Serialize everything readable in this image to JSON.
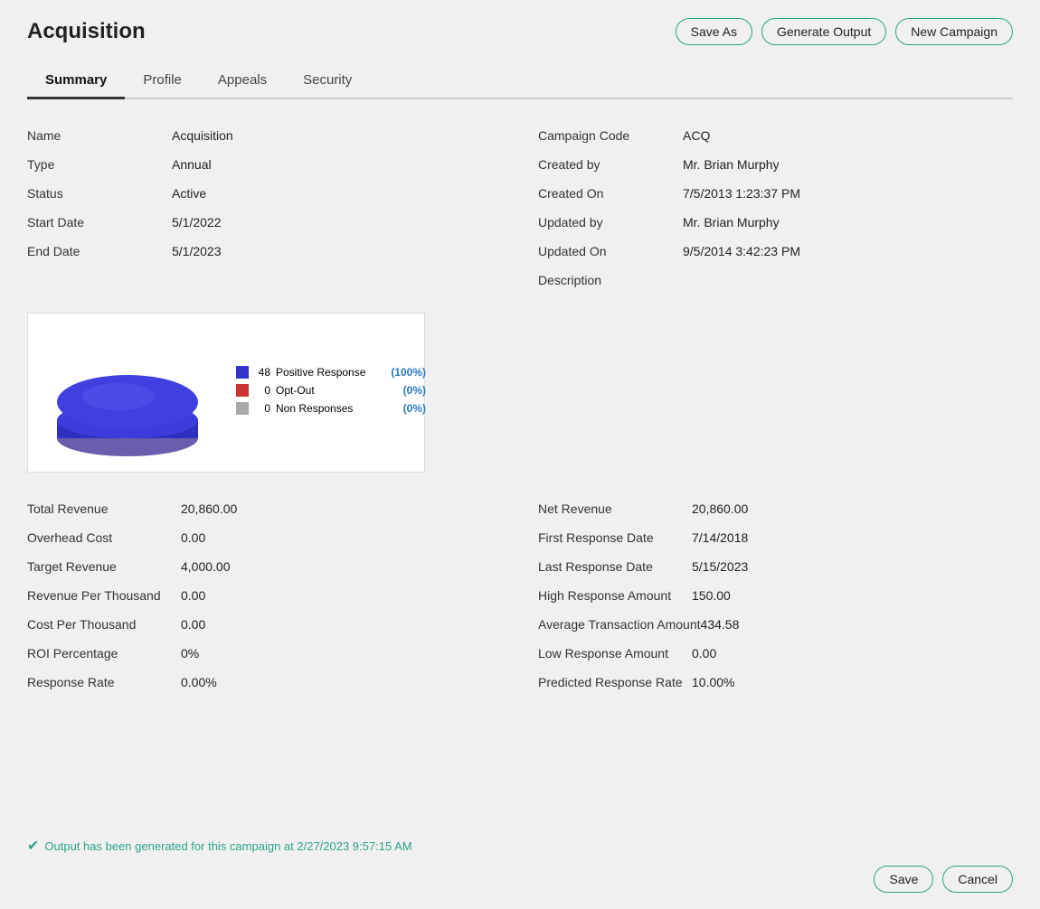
{
  "page": {
    "title": "Acquisition"
  },
  "header": {
    "save_as_label": "Save As",
    "generate_output_label": "Generate Output",
    "new_campaign_label": "New Campaign"
  },
  "tabs": [
    {
      "id": "summary",
      "label": "Summary",
      "active": true
    },
    {
      "id": "profile",
      "label": "Profile",
      "active": false
    },
    {
      "id": "appeals",
      "label": "Appeals",
      "active": false
    },
    {
      "id": "security",
      "label": "Security",
      "active": false
    }
  ],
  "summary": {
    "name_label": "Name",
    "name_value": "Acquisition",
    "type_label": "Type",
    "type_value": "Annual",
    "status_label": "Status",
    "status_value": "Active",
    "start_date_label": "Start Date",
    "start_date_value": "5/1/2022",
    "end_date_label": "End Date",
    "end_date_value": "5/1/2023",
    "campaign_code_label": "Campaign Code",
    "campaign_code_value": "ACQ",
    "created_by_label": "Created by",
    "created_by_value": "Mr. Brian Murphy",
    "created_on_label": "Created On",
    "created_on_value": "7/5/2013 1:23:37 PM",
    "updated_by_label": "Updated by",
    "updated_by_value": "Mr. Brian Murphy",
    "updated_on_label": "Updated On",
    "updated_on_value": "9/5/2014 3:42:23 PM",
    "description_label": "Description",
    "description_value": "",
    "chart": {
      "positive_response_count": "48",
      "positive_response_label": "Positive Response",
      "positive_response_pct": "(100%)",
      "opt_out_count": "0",
      "opt_out_label": "Opt-Out",
      "opt_out_pct": "(0%)",
      "non_responses_count": "0",
      "non_responses_label": "Non Responses",
      "non_responses_pct": "(0%)"
    },
    "total_revenue_label": "Total Revenue",
    "total_revenue_value": "20,860.00",
    "overhead_cost_label": "Overhead Cost",
    "overhead_cost_value": "0.00",
    "target_revenue_label": "Target Revenue",
    "target_revenue_value": "4,000.00",
    "revenue_per_thousand_label": "Revenue Per Thousand",
    "revenue_per_thousand_value": "0.00",
    "cost_per_thousand_label": "Cost Per Thousand",
    "cost_per_thousand_value": "0.00",
    "roi_percentage_label": "ROI Percentage",
    "roi_percentage_value": "0%",
    "response_rate_label": "Response Rate",
    "response_rate_value": "0.00%",
    "net_revenue_label": "Net Revenue",
    "net_revenue_value": "20,860.00",
    "first_response_date_label": "First Response Date",
    "first_response_date_value": "7/14/2018",
    "last_response_date_label": "Last Response Date",
    "last_response_date_value": "5/15/2023",
    "high_response_amount_label": "High Response Amount",
    "high_response_amount_value": "150.00",
    "avg_transaction_amount_label": "Average Transaction Amount",
    "avg_transaction_amount_value": "434.58",
    "low_response_amount_label": "Low Response Amount",
    "low_response_amount_value": "0.00",
    "predicted_response_rate_label": "Predicted Response Rate",
    "predicted_response_rate_value": "10.00%"
  },
  "footer": {
    "output_message": "Output has been generated for this campaign at 2/27/2023 9:57:15 AM",
    "save_label": "Save",
    "cancel_label": "Cancel"
  }
}
